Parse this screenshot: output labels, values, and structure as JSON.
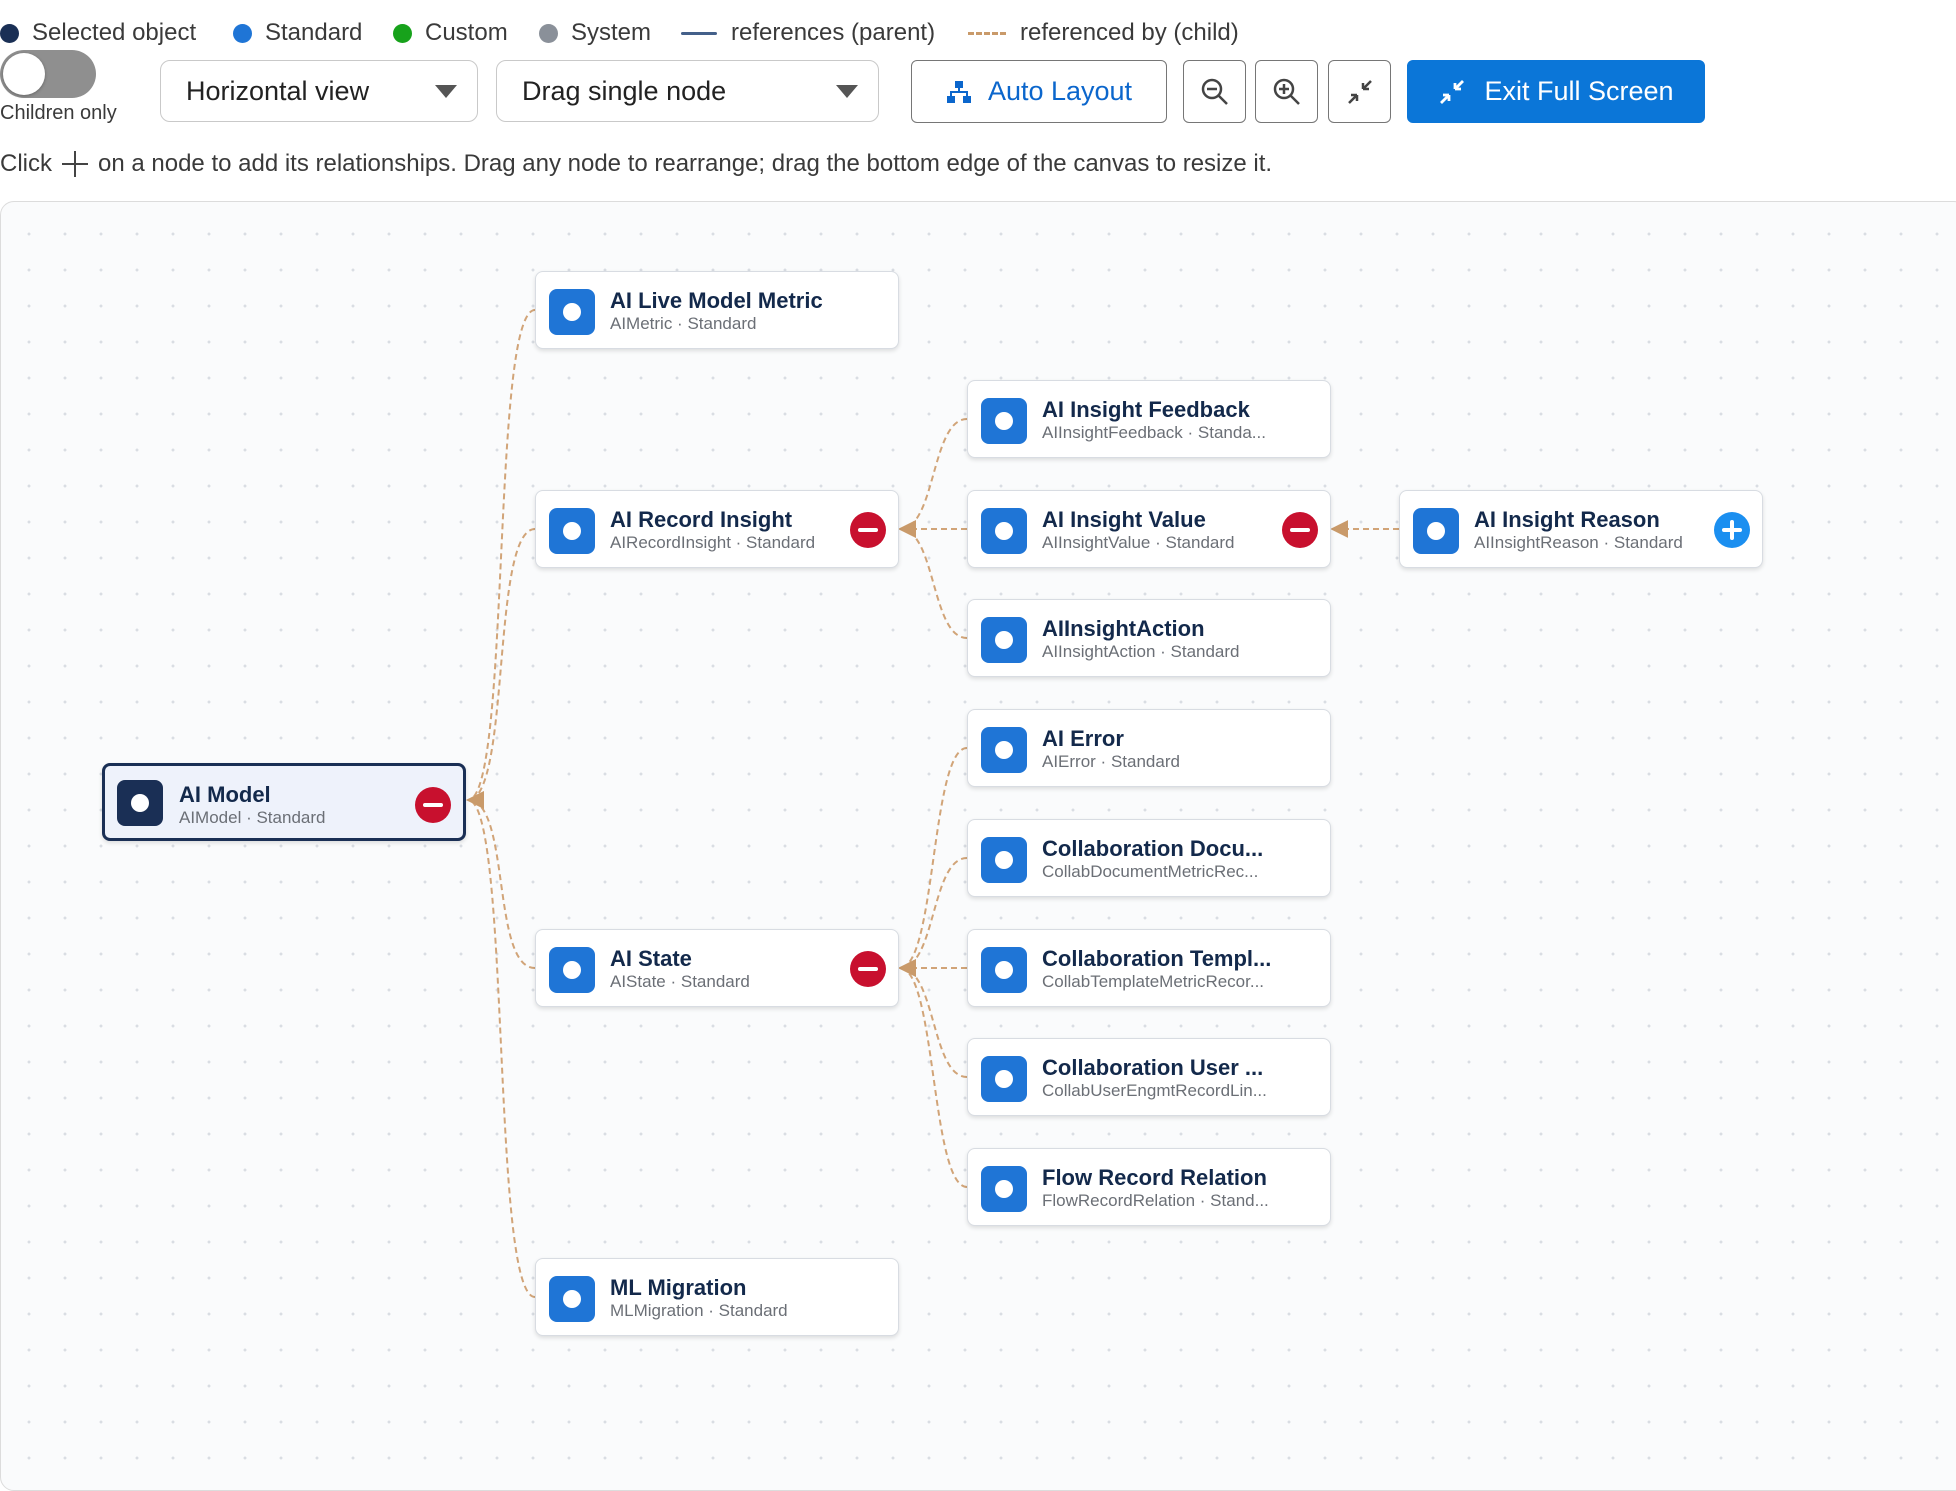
{
  "legend": {
    "selected": "Selected object",
    "standard": "Standard",
    "custom": "Custom",
    "system": "System",
    "references": "references (parent)",
    "referenced_by": "referenced by (child)"
  },
  "colors": {
    "selected": "#1a2f55",
    "standard": "#1f75d6",
    "custom": "#17a21b",
    "system": "#8a9099",
    "edge": "#c99a6a",
    "primary": "#0b76d8",
    "remove": "#c8102e",
    "add": "#1b8ff0"
  },
  "toolbar": {
    "toggle_label": "Children only",
    "toggle_on": false,
    "view_select": "Horizontal view",
    "drag_select": "Drag single node",
    "auto_layout": "Auto Layout",
    "exit_fullscreen": "Exit Full Screen"
  },
  "hint": {
    "before": "Click",
    "after": "on a node to add its relationships. Drag any node to rearrange; drag the bottom edge of the canvas to resize it."
  },
  "nodes": {
    "ai_model": {
      "title": "AI Model",
      "sub": "AIModel · Standard"
    },
    "ai_live_model_metric": {
      "title": "AI Live Model Metric",
      "sub": "AIMetric · Standard"
    },
    "ai_record_insight": {
      "title": "AI Record Insight",
      "sub": "AIRecordInsight · Standard"
    },
    "ai_state": {
      "title": "AI State",
      "sub": "AIState · Standard"
    },
    "ml_migration": {
      "title": "ML Migration",
      "sub": "MLMigration · Standard"
    },
    "ai_insight_feedback": {
      "title": "AI Insight Feedback",
      "sub": "AIInsightFeedback · Standa..."
    },
    "ai_insight_value": {
      "title": "AI Insight Value",
      "sub": "AIInsightValue · Standard"
    },
    "ai_insight_action": {
      "title": "AIInsightAction",
      "sub": "AIInsightAction · Standard"
    },
    "ai_error": {
      "title": "AI Error",
      "sub": "AIError · Standard"
    },
    "collab_docu": {
      "title": "Collaboration Docu...",
      "sub": "CollabDocumentMetricRec..."
    },
    "collab_templ": {
      "title": "Collaboration Templ...",
      "sub": "CollabTemplateMetricRecor..."
    },
    "collab_user": {
      "title": "Collaboration User ...",
      "sub": "CollabUserEngmtRecordLin..."
    },
    "flow_record": {
      "title": "Flow Record Relation",
      "sub": "FlowRecordRelation · Stand..."
    },
    "ai_insight_reason": {
      "title": "AI Insight Reason",
      "sub": "AIInsightReason · Standard"
    }
  }
}
